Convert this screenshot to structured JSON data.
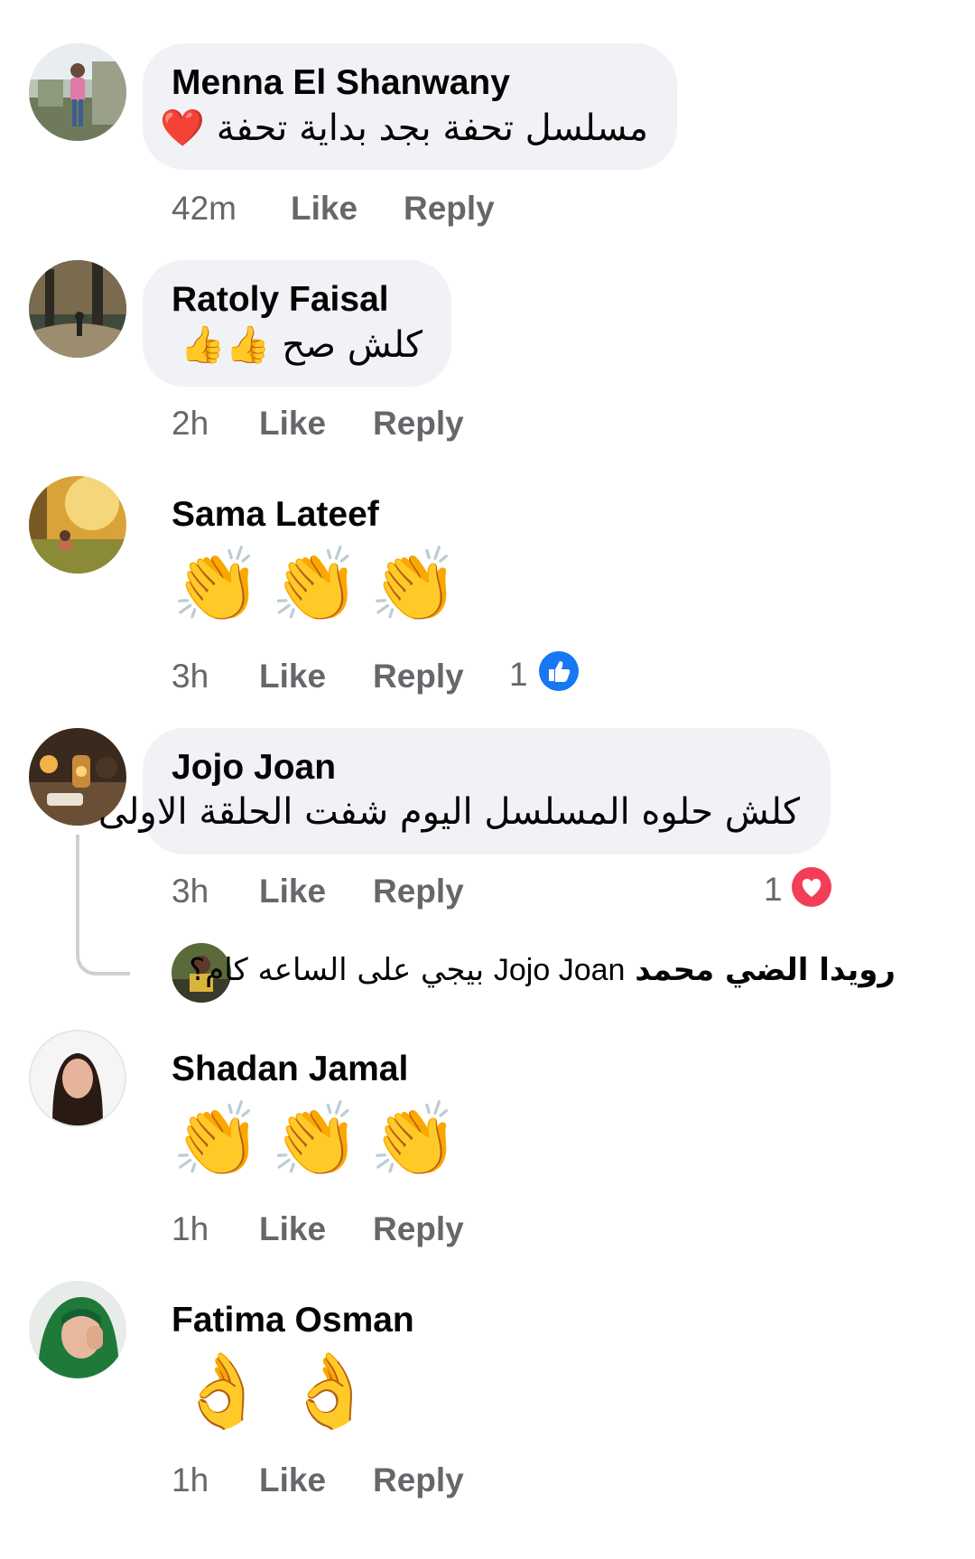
{
  "comments": [
    {
      "author": "Menna El Shanwany",
      "text": "مسلسل تحفة بجد بداية تحفة ❤️",
      "time": "42m",
      "like": "Like",
      "reply": "Reply"
    },
    {
      "author": "Ratoly Faisal",
      "text": "كلش صح 👍👍",
      "time": "2h",
      "like": "Like",
      "reply": "Reply"
    },
    {
      "author": "Sama Lateef",
      "text": "👏👏👏",
      "time": "3h",
      "like": "Like",
      "reply": "Reply",
      "reaction_count": "1"
    },
    {
      "author": "Jojo Joan",
      "text": "كلش حلوه المسلسل اليوم شفت الحلقة الاولى",
      "time": "3h",
      "like": "Like",
      "reply": "Reply",
      "reaction_count": "1",
      "reply_preview": {
        "author": "رويدا الضي محمد",
        "mention": "Jojo Joan",
        "text": "بيجي على الساعه كام؟"
      }
    },
    {
      "author": "Shadan Jamal",
      "text": "👏👏👏",
      "time": "1h",
      "like": "Like",
      "reply": "Reply"
    },
    {
      "author": "Fatima Osman",
      "text": "👌👌",
      "time": "1h",
      "like": "Like",
      "reply": "Reply"
    }
  ],
  "colors": {
    "bubble": "#f0f2f5",
    "secondary_text": "#65676b",
    "like_blue": "#1877f2",
    "love_red": "#f33e58"
  }
}
